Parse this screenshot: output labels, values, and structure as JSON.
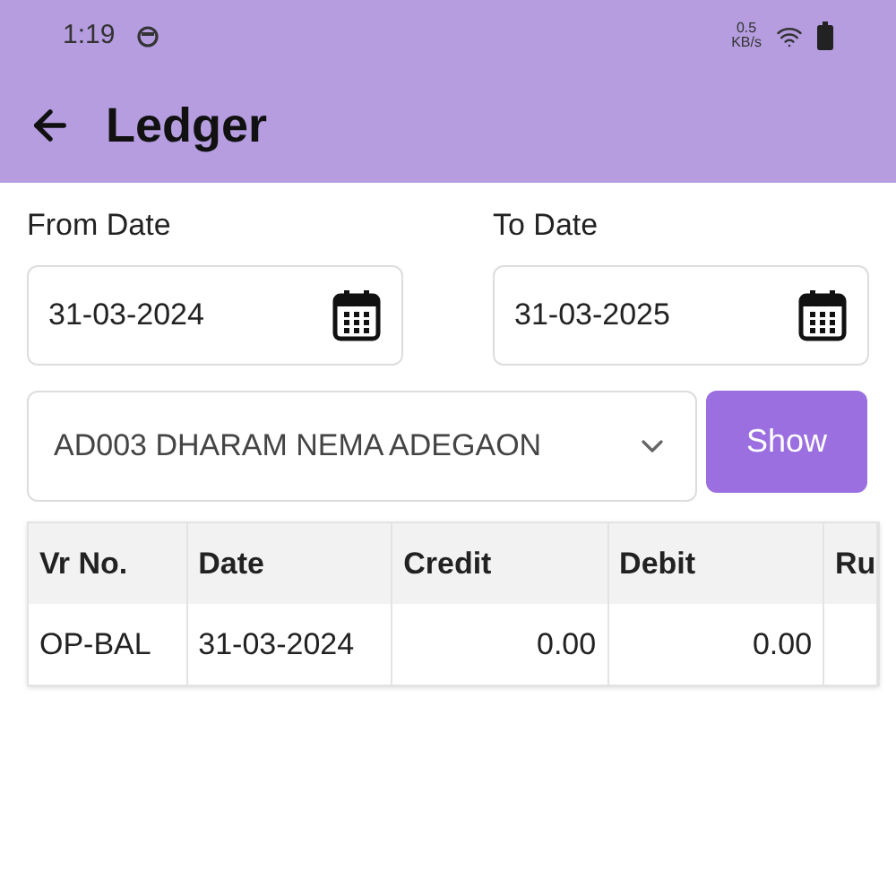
{
  "status_bar": {
    "time": "1:19",
    "speed_value": "0.5",
    "speed_unit": "KB/s"
  },
  "app_bar": {
    "title": "Ledger"
  },
  "from_date": {
    "label": "From Date",
    "value": "31-03-2024"
  },
  "to_date": {
    "label": "To Date",
    "value": "31-03-2025"
  },
  "account": {
    "value": "AD003 DHARAM NEMA ADEGAON"
  },
  "show_button": "Show",
  "table": {
    "columns": [
      "Vr No.",
      "Date",
      "Credit",
      "Debit",
      "Ru"
    ],
    "rows": [
      [
        "OP-BAL",
        "31-03-2024",
        "0.00",
        "0.00",
        ""
      ]
    ]
  }
}
